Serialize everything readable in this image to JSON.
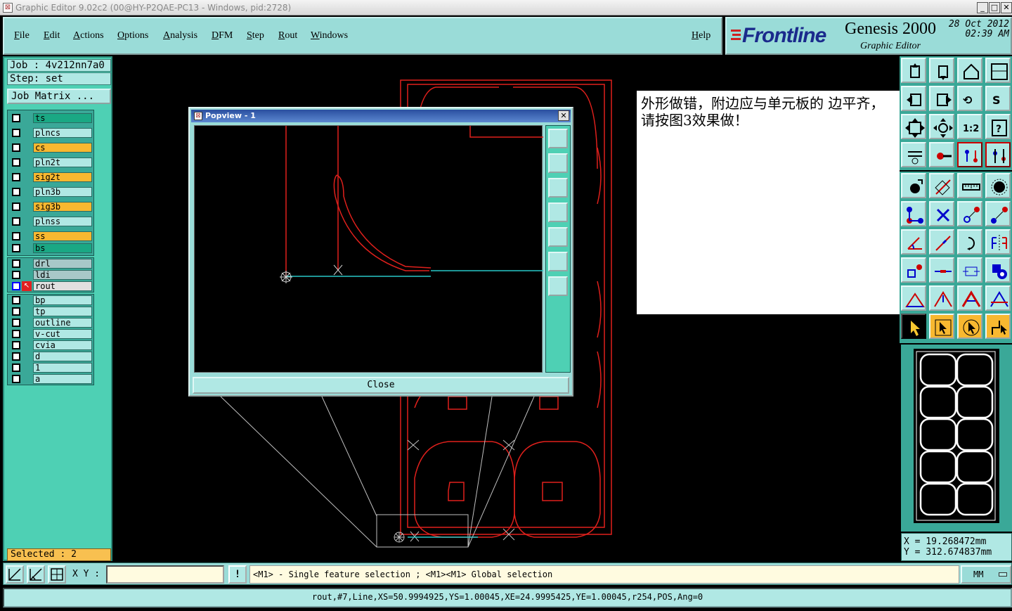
{
  "window": {
    "title": "Graphic Editor 9.02c2 (00@HY-P2QAE-PC13 - Windows, pid:2728)",
    "min": "_",
    "max": "□",
    "close": "✕"
  },
  "menu": {
    "items": [
      "File",
      "Edit",
      "Actions",
      "Options",
      "Analysis",
      "DFM",
      "Step",
      "Rout",
      "Windows"
    ],
    "help": "Help"
  },
  "brand": {
    "logo": "Frontline",
    "product": "Genesis 2000",
    "module": "Graphic Editor",
    "date": "28 Oct 2012",
    "time": "02:39 AM"
  },
  "job": {
    "job_line": "Job : 4v212nn7a0",
    "step_line": "Step: set",
    "matrix_button": "Job Matrix ..."
  },
  "layers": [
    {
      "name": "ts",
      "color": "#1aa884"
    },
    {
      "name": "plncs",
      "color": "#b0e8e4"
    },
    {
      "name": "cs",
      "color": "#f8b830"
    },
    {
      "name": "pln2t",
      "color": "#b0e8e4"
    },
    {
      "name": "sig2t",
      "color": "#f8b830"
    },
    {
      "name": "pln3b",
      "color": "#b0e8e4"
    },
    {
      "name": "sig3b",
      "color": "#f8b830"
    },
    {
      "name": "plnss",
      "color": "#b0e8e4"
    },
    {
      "name": "ss",
      "color": "#f8b830"
    },
    {
      "name": "bs",
      "color": "#1aa884"
    },
    {
      "name": "drl",
      "color": "#a8c8c8"
    },
    {
      "name": "ldi",
      "color": "#a8c8c8"
    },
    {
      "name": "rout",
      "color": "#e0e0e0"
    },
    {
      "name": "bp",
      "color": "#b0e8e4"
    },
    {
      "name": "tp",
      "color": "#b0e8e4"
    },
    {
      "name": "outline",
      "color": "#b0e8e4"
    },
    {
      "name": "v-cut",
      "color": "#b0e8e4"
    },
    {
      "name": "cvia",
      "color": "#b0e8e4"
    },
    {
      "name": "d",
      "color": "#b0e8e4"
    },
    {
      "name": "1",
      "color": "#b0e8e4"
    },
    {
      "name": "a",
      "color": "#b0e8e4"
    }
  ],
  "selected": "Selected : 2",
  "note": {
    "text": "外形做错，附边应与单元板的 边平齐，请按图3效果做！"
  },
  "popview": {
    "title": "Popview - 1",
    "close_label": "Close"
  },
  "coords": {
    "x": "X = 19.268472mm",
    "y": "Y = 312.674837mm"
  },
  "bottom": {
    "xy_label": "X Y :",
    "xy_value": "",
    "excl": "!",
    "hint": "<M1> - Single feature selection ; <M1><M1> Global selection",
    "units": "MM"
  },
  "status": "rout,#7,Line,XS=50.9994925,YS=1.00045,XE=24.9995425,YE=1.00045,r254,POS,Ang=0",
  "tool_icons": {
    "palette1": [
      "open-job-icon",
      "save-icon",
      "home-icon",
      "window-icon",
      "prev-step-icon",
      "next-step-icon",
      "undo-icon",
      "redo-icon",
      "zoom-fit-icon",
      "zoom-center-icon",
      "ratio-icon",
      "help-icon",
      "settings-icon",
      "snap-icon",
      "netlist-icon",
      "netlist2-icon"
    ],
    "palette2": [
      "add-pad-icon",
      "add-line-icon",
      "measure-icon",
      "add-circle-icon",
      "connect-icon",
      "delete-icon",
      "move-icon",
      "copy-icon",
      "edit-icon",
      "resize-icon",
      "rotate-icon",
      "mirror-icon",
      "transform-icon",
      "contour-icon",
      "dim-icon",
      "shapes-icon",
      "polygon-icon",
      "polygon2-icon",
      "polygon3-icon",
      "polygon4-icon",
      "select-icon",
      "select2-icon",
      "select3-icon",
      "route-icon"
    ]
  }
}
